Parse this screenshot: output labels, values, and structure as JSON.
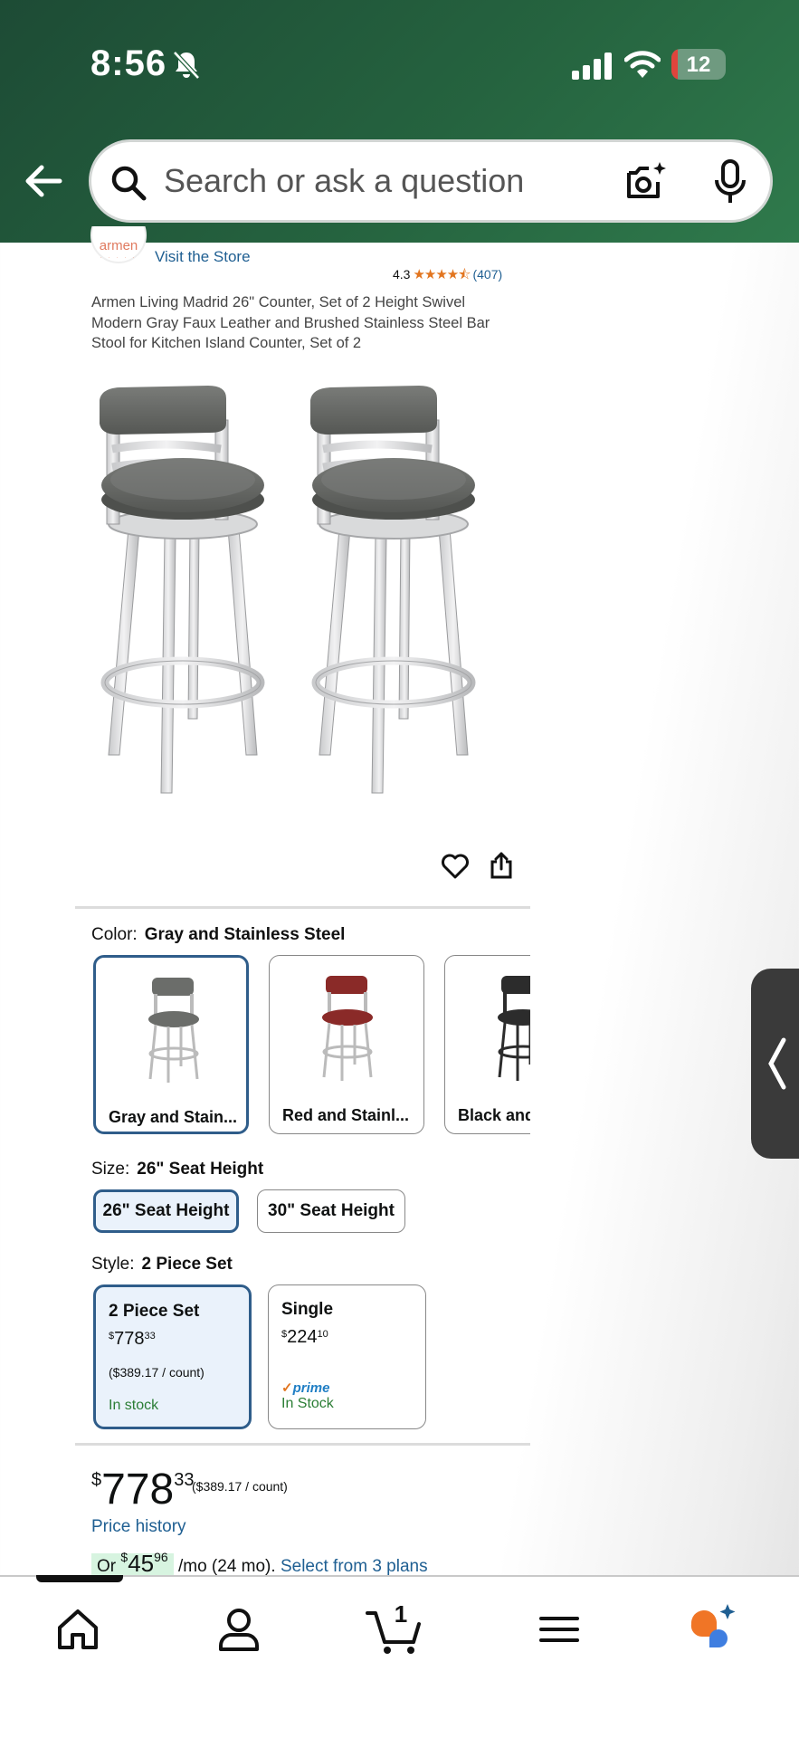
{
  "status_bar": {
    "time": "8:56",
    "battery": "12",
    "battery_level": 0.12
  },
  "search": {
    "placeholder": "Search or ask a question"
  },
  "store": {
    "logo_text": "armen",
    "link": "Visit the Store"
  },
  "rating": {
    "value": "4.3",
    "stars": "★★★★⯪",
    "count": "(407)"
  },
  "product": {
    "title": "Armen Living Madrid 26\" Counter, Set of 2 Height Swivel Modern Gray Faux Leather and Brushed Stainless Steel Bar Stool for Kitchen Island Counter, Set of 2"
  },
  "color": {
    "label": "Color:",
    "selected": "Gray and Stainless Steel",
    "options": [
      {
        "label": "Gray and Stain...",
        "seat_color": "#6b6d6a"
      },
      {
        "label": "Red and Stainl...",
        "seat_color": "#8a2a28"
      },
      {
        "label": "Black and",
        "seat_color": "#2c2c2c"
      }
    ]
  },
  "size": {
    "label": "Size:",
    "selected": "26\" Seat Height",
    "options": [
      "26\" Seat Height",
      "30\" Seat Height"
    ]
  },
  "style": {
    "label": "Style:",
    "selected": "2 Piece Set",
    "options": [
      {
        "name": "2 Piece Set",
        "price_dollars": "778",
        "price_cents": "33",
        "currency": "$",
        "unit": "($389.17 / count)",
        "prime": "",
        "stock": "In stock"
      },
      {
        "name": "Single",
        "price_dollars": "224",
        "price_cents": "10",
        "currency": "$",
        "unit": "",
        "prime": "prime",
        "stock": "In Stock"
      }
    ]
  },
  "price": {
    "currency": "$",
    "dollars": "778",
    "cents": "33",
    "unit": "($389.17 / count)",
    "history": "Price history",
    "monthly_prefix": "Or ",
    "monthly_currency": "$",
    "monthly_dollars": "45",
    "monthly_cents": "96",
    "monthly_suffix": "/mo (24 mo).",
    "plans_link": "Select from 3 plans"
  },
  "nav": {
    "cart_count": "1",
    "items": [
      "home-icon",
      "account-icon",
      "cart-icon",
      "menu-icon",
      "rufus-icon"
    ]
  },
  "colors": {
    "accent": "#2f5d8a",
    "link": "#1f5f92",
    "stock": "#2a7d34",
    "header": "#25633f"
  }
}
